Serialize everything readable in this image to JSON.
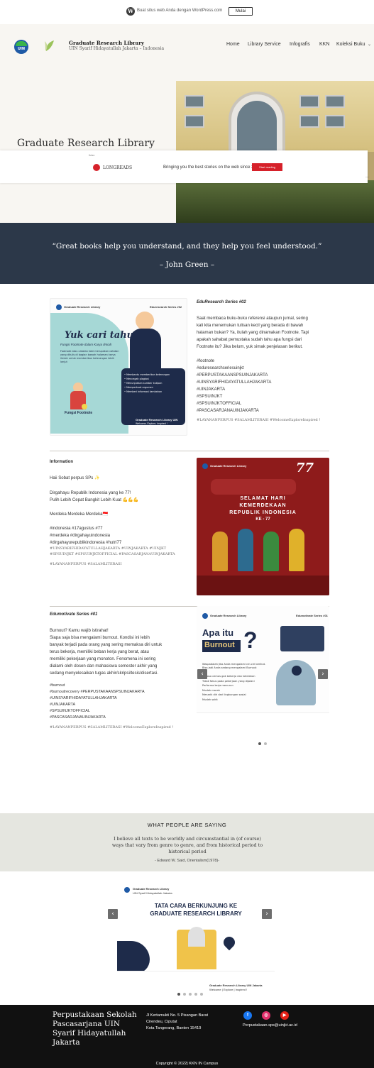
{
  "wp_bar": {
    "text": "Buat situs web Anda dengan WordPress.com",
    "button": "Mulai"
  },
  "header": {
    "logo_text": "UIN",
    "site_title": "Graduate Research Library",
    "tagline": "UIN Syarif Hidayatullah Jakarta – Indonesia",
    "nav": [
      "Home",
      "Library Service",
      "Infografis",
      "KKN",
      "Koleksi Buku"
    ]
  },
  "hero": {
    "title": "Graduate Research Library"
  },
  "ad": {
    "label": "Iklan",
    "brand": "LONGREADS",
    "tagline": "Bringing you the best stories on the web since 2009.",
    "button": "Start reading",
    "more": "..."
  },
  "quote": {
    "text": "“Great books help you understand, and they help you feel understood.”",
    "author": "– John Green –"
  },
  "posts": [
    {
      "title": "EduResearch Series #02",
      "body": [
        "Saat membaca buku-buku referensi ataupun jurnal, sering",
        "kali kita menemukan tulisan kecil yang berada di bawah",
        "halaman bukan? Ya, itulah yang dinamakan Footnote. Tapi",
        "apakah sahabat pemustaka sudah tahu apa fungsi dari",
        "Footnote itu? Jika belum, yuk simak penjelasan berikut."
      ],
      "tags": [
        "#footnote",
        "#eduresearchseriesuinjkt",
        "#PERPUSTAKAANSPSUINJAKARTA",
        "#UINSYARIFHIDAYATULLAHJAKARTA",
        "#UINJAKARTA",
        "#SPSUINJKT",
        "#SPSUINJKTOFFICIAL",
        "#PASCASARJANAUINJAKARTA"
      ],
      "footer": "#LAYANANPERPUS #SALAMLITERASI #WelcomeExploreInspired !",
      "image": {
        "series_label": "Eduresearch Series #02",
        "heading": "Yuk cari tahu !",
        "subheading": "Fungsi Footnote dalam Karya Ilmiah",
        "caption_left": "Fungsi Footnote",
        "footer_brand": "Graduate Research Library UIN",
        "footer_tag": "Welcome, Explore, Inspired !"
      }
    },
    {
      "title": "Information",
      "intro": "Haii Sobat perpus SPs ✨",
      "body": [
        "Dirgahayu Republik Indonesia yang ke 77!",
        "Pulih Lebih Cepat Bangkit Lebih Kuat 💪💪💪",
        "",
        "Merdeka Merdeka Merdeka🇮🇩",
        "",
        "#indonesia #17agustus #77",
        "#merdeka #dirgahayuindonesia",
        "#dirgahayurepublikindonesia #hutri77"
      ],
      "tags_line1": "#UINSYARIFHIDAYATULLAHJAKARTA #UINJAKARTA #UINJKT",
      "tags_line2": "#SPSUINJKT #SPSUINJKTOFFICIAL #PASCASARJANAUINJAKARTA",
      "footer": "#LAYANANPERPUS #SALAMLITERASI",
      "image": {
        "line1": "SELAMAT HARI",
        "line2": "KEMERDEKAAN",
        "line3": "REPUBLIK INDONESIA",
        "line4": "KE - 77",
        "badge": "77"
      }
    },
    {
      "title": "Edumotivate Series #01",
      "body": [
        "Burnout? Kamu wajib istirahat!",
        "Siapa saja bisa mengalami burnout. Kondisi ini lebih",
        "banyak terjadi pada orang yang sering memaksa diri untuk",
        "terus bekerja, memiliki beban kerja yang berat, atau",
        "memiliki pekerjaan yang monoton. Fenomena ini sering",
        "dialami oleh dosen dan mahasiswa semester akhir yang",
        "sedang menyelesaikan tugas akhir/skripsi/tesis/disertasi."
      ],
      "tags": [
        "#burnout",
        "#burnoutrecovery #PERPUSTAKAANSPSUINJAKARTA",
        "#UINSYARIFHIDAYATULLAHJAKARTA",
        "#UINJAKARTA",
        "#SPSUINJKTOFFICIAL",
        "#PASCASARJANAUINJAKARTA"
      ],
      "footer": "#LAYANANPERPUS #SALAMLITERASI #WelcomeExploreInspired !",
      "image": {
        "heading1": "Apa itu",
        "heading2": "Burnout",
        "qmark": "?",
        "series_label": "Edumotivate Series #01",
        "lead": "Waspadalah Jika Anda mengalami ciri-ciri berikut. Bisa jadi Anda sedang mengalami Burnout",
        "items": [
          "Merasa cemas gak bekerja dan kelelahan",
          "Tidak fokus pada pekerjaan yang dijalani",
          "Performa kerja menurun",
          "Mudah marah",
          "Menarik diri dari lingkungan sosial",
          "Mudah sakit"
        ]
      }
    }
  ],
  "testimonial": {
    "heading": "WHAT PEOPLE ARE SAYING",
    "quote": "I believe all texts to be worldly and circumstantial in (of course) ways that vary from genre to genre, and from historical period to historical period",
    "author": "- Edward W. Said, Orientalism(1978)-"
  },
  "slider": {
    "org": "Graduate Research Library",
    "org_sub": "UIN Syarif Hidayatullah Jakarta",
    "title1": "TATA CARA BERKUNJUNG KE",
    "title2": "GRADUATE RESEARCH LIBRARY",
    "footer_brand": "Graduate Research Library UIN Jakarta",
    "footer_tag": "Welcome | Explore | Inspired !"
  },
  "footer": {
    "name": "Perpustakaan Sekolah Pascasarjana UIN Syarif Hidayatullah Jakarta",
    "address_lines": [
      "Jl Kertamukti No. 5 Pisangan Barat",
      "Cirendeu, Ciputat",
      "Kota Tangerang, Banten 15419"
    ],
    "email": "Perpustakaan.sps@uinjkt.ac.id",
    "copyright": "Copyright © 2022| KKN IN Campus",
    "colors": {
      "facebook": "#1877f2",
      "instagram": "#e1306c",
      "youtube": "#e62117"
    }
  }
}
